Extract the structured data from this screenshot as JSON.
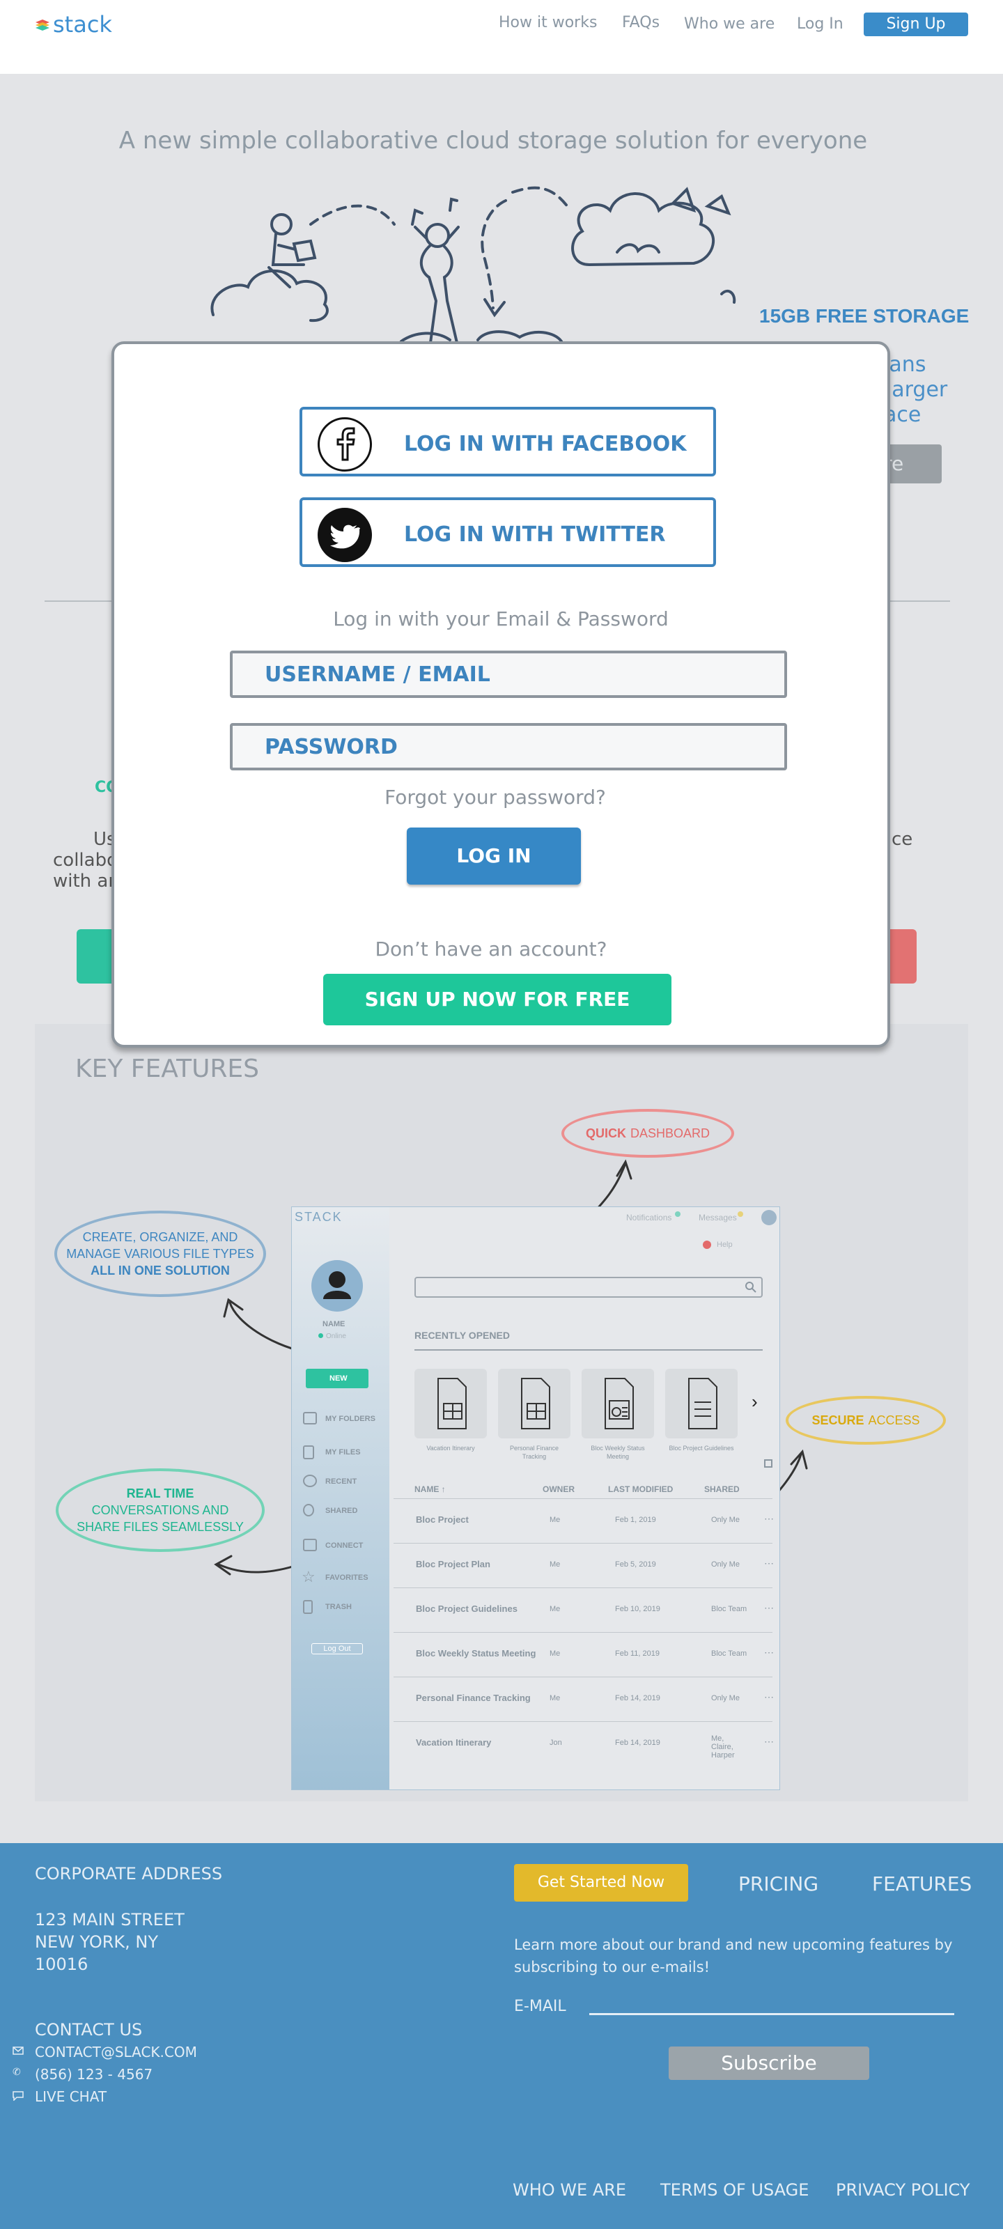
{
  "header": {
    "logo_text": "stack",
    "nav": [
      "How it works",
      "FAQs",
      "Who we are",
      "Log In"
    ],
    "signup_label": "Sign Up"
  },
  "hero": {
    "title": "A new simple collaborative cloud storage solution for everyone",
    "free_storage": "15GB FREE STORAGE",
    "plans_text": [
      "Plans",
      "r larger",
      "pace"
    ],
    "plans_button": "ore"
  },
  "peek": {
    "left_heading": "CO",
    "left_line1": "Us",
    "left_line2": "collabo",
    "left_line3": "with an",
    "right_line1": "ce"
  },
  "modal": {
    "facebook_label": "LOG IN WITH FACEBOOK",
    "twitter_label": "LOG IN WITH TWITTER",
    "email_prompt": "Log in with your Email & Password",
    "username_placeholder": "USERNAME / EMAIL",
    "password_placeholder": "PASSWORD",
    "forgot": "Forgot your password?",
    "login_button": "LOG IN",
    "no_account": "Don’t have an account?",
    "signup_button": "SIGN UP NOW FOR FREE"
  },
  "features": {
    "title": "KEY FEATURES",
    "bubble_dashboard_bold": "QUICK",
    "bubble_dashboard_rest": "DASHBOARD",
    "bubble_create_1": "CREATE, ORGANIZE, AND",
    "bubble_create_2": "MANAGE VARIOUS FILE TYPES",
    "bubble_create_3": "ALL IN ONE SOLUTION",
    "bubble_secure_bold": "SECURE",
    "bubble_secure_rest": "ACCESS",
    "bubble_realtime_1": "REAL TIME",
    "bubble_realtime_2": "CONVERSATIONS AND",
    "bubble_realtime_3": "SHARE FILES SEAMLESSLY"
  },
  "mock": {
    "logo": "STACK",
    "notifications": "Notifications",
    "messages": "Messages",
    "help": "Help",
    "name": "NAME",
    "status": "Online",
    "new": "NEW",
    "side_items": [
      "MY FOLDERS",
      "MY FILES",
      "RECENT",
      "SHARED",
      "CONNECT",
      "FAVORITES",
      "TRASH"
    ],
    "logout": "Log Out",
    "recently_opened": "RECENTLY OPENED",
    "cards": [
      "Vacation Itinerary",
      "Personal Finance Tracking",
      "Bloc Weekly Status Meeting",
      "Bloc Project Guidelines"
    ],
    "columns": [
      "NAME ↑",
      "OWNER",
      "LAST MODIFIED",
      "SHARED"
    ],
    "rows": [
      {
        "name": "Bloc Project",
        "owner": "Me",
        "date": "Feb 1, 2019",
        "shared": "Only Me"
      },
      {
        "name": "Bloc Project Plan",
        "owner": "Me",
        "date": "Feb 5, 2019",
        "shared": "Only Me"
      },
      {
        "name": "Bloc Project Guidelines",
        "owner": "Me",
        "date": "Feb 10, 2019",
        "shared": "Bloc Team"
      },
      {
        "name": "Bloc Weekly Status Meeting",
        "owner": "Me",
        "date": "Feb 11, 2019",
        "shared": "Bloc Team"
      },
      {
        "name": "Personal Finance Tracking",
        "owner": "Me",
        "date": "Feb 14, 2019",
        "shared": "Only Me"
      },
      {
        "name": "Vacation Itinerary",
        "owner": "Jon",
        "date": "Feb 14, 2019",
        "shared": "Me, Claire, Harper"
      }
    ]
  },
  "footer": {
    "corporate_heading": "CORPORATE ADDRESS",
    "address_1": "123 MAIN STREET",
    "address_2": "NEW YORK, NY",
    "address_3": "10016",
    "contact_heading": "CONTACT US",
    "email": "CONTACT@SLACK.COM",
    "phone": "(856) 123 - 4567",
    "chat": "LIVE CHAT",
    "get_started": "Get Started Now",
    "pricing": "PRICING",
    "features": "FEATURES",
    "learn_more": "Learn more about our brand and new upcoming features by subscribing to our e-mails!",
    "email_label": "E-MAIL",
    "subscribe": "Subscribe",
    "links": [
      "WHO WE ARE",
      "TERMS OF USAGE",
      "PRIVACY POLICY"
    ]
  },
  "colors": {
    "brand_blue": "#3a8cc9",
    "teal": "#1ec79a",
    "footer_blue": "#4a8fc0",
    "yellow": "#e3b92b",
    "coral": "#e27272"
  }
}
